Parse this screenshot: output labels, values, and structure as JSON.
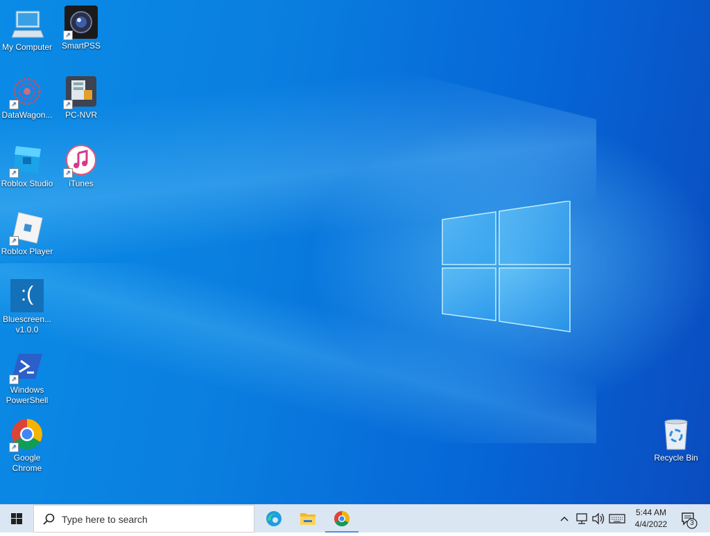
{
  "desktop_icons": [
    {
      "label": "My Computer",
      "icon": "computer-icon"
    },
    {
      "label": "SmartPSS",
      "icon": "camera-lens-icon"
    },
    {
      "label": "DataWagon...",
      "icon": "datawagon-icon"
    },
    {
      "label": "PC-NVR",
      "icon": "pc-nvr-icon"
    },
    {
      "label": "Roblox Studio",
      "icon": "roblox-studio-icon"
    },
    {
      "label": "iTunes",
      "icon": "itunes-icon"
    },
    {
      "label": "Roblox Player",
      "icon": "roblox-player-icon"
    },
    {
      "label_line1": "Bluescreen...",
      "label_line2": "v1.0.0",
      "icon": "bluescreen-icon"
    },
    {
      "label_line1": "Windows",
      "label_line2": "PowerShell",
      "icon": "powershell-icon"
    },
    {
      "label_line1": "Google",
      "label_line2": "Chrome",
      "icon": "chrome-icon"
    },
    {
      "label": "Recycle Bin",
      "icon": "recycle-bin-icon"
    }
  ],
  "bluescreen_glyph": ":(",
  "taskbar": {
    "search_placeholder": "Type here to search",
    "pinned": [
      "edge-icon",
      "file-explorer-icon",
      "chrome-icon"
    ],
    "clock_time": "5:44 AM",
    "clock_date": "4/4/2022",
    "notification_count": "3"
  },
  "colors": {
    "desktop_blue": "#0a7fe0",
    "taskbar_bg": "#dbe6f3",
    "active_indicator": "#4a90e2"
  }
}
